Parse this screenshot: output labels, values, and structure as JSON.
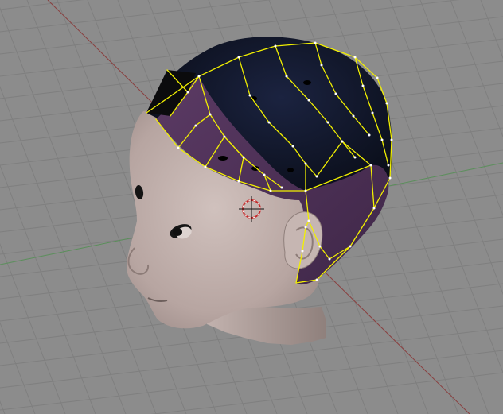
{
  "viewport": {
    "background": "#8c8c8c",
    "grid_color": "#7f7f7f",
    "x_axis_color": "#8a3f3f",
    "y_axis_color": "#5a8f5a"
  },
  "model": {
    "skin_color": "#b8a7a3",
    "hair_dark_color": "#0c1424",
    "hair_selected_color": "#4f3558",
    "edge_selected_color": "#f2f000",
    "vertex_color": "#ffffff"
  },
  "cursor": {
    "color_red": "#c42a2a",
    "color_white": "#ffffff",
    "color_black": "#111111"
  }
}
